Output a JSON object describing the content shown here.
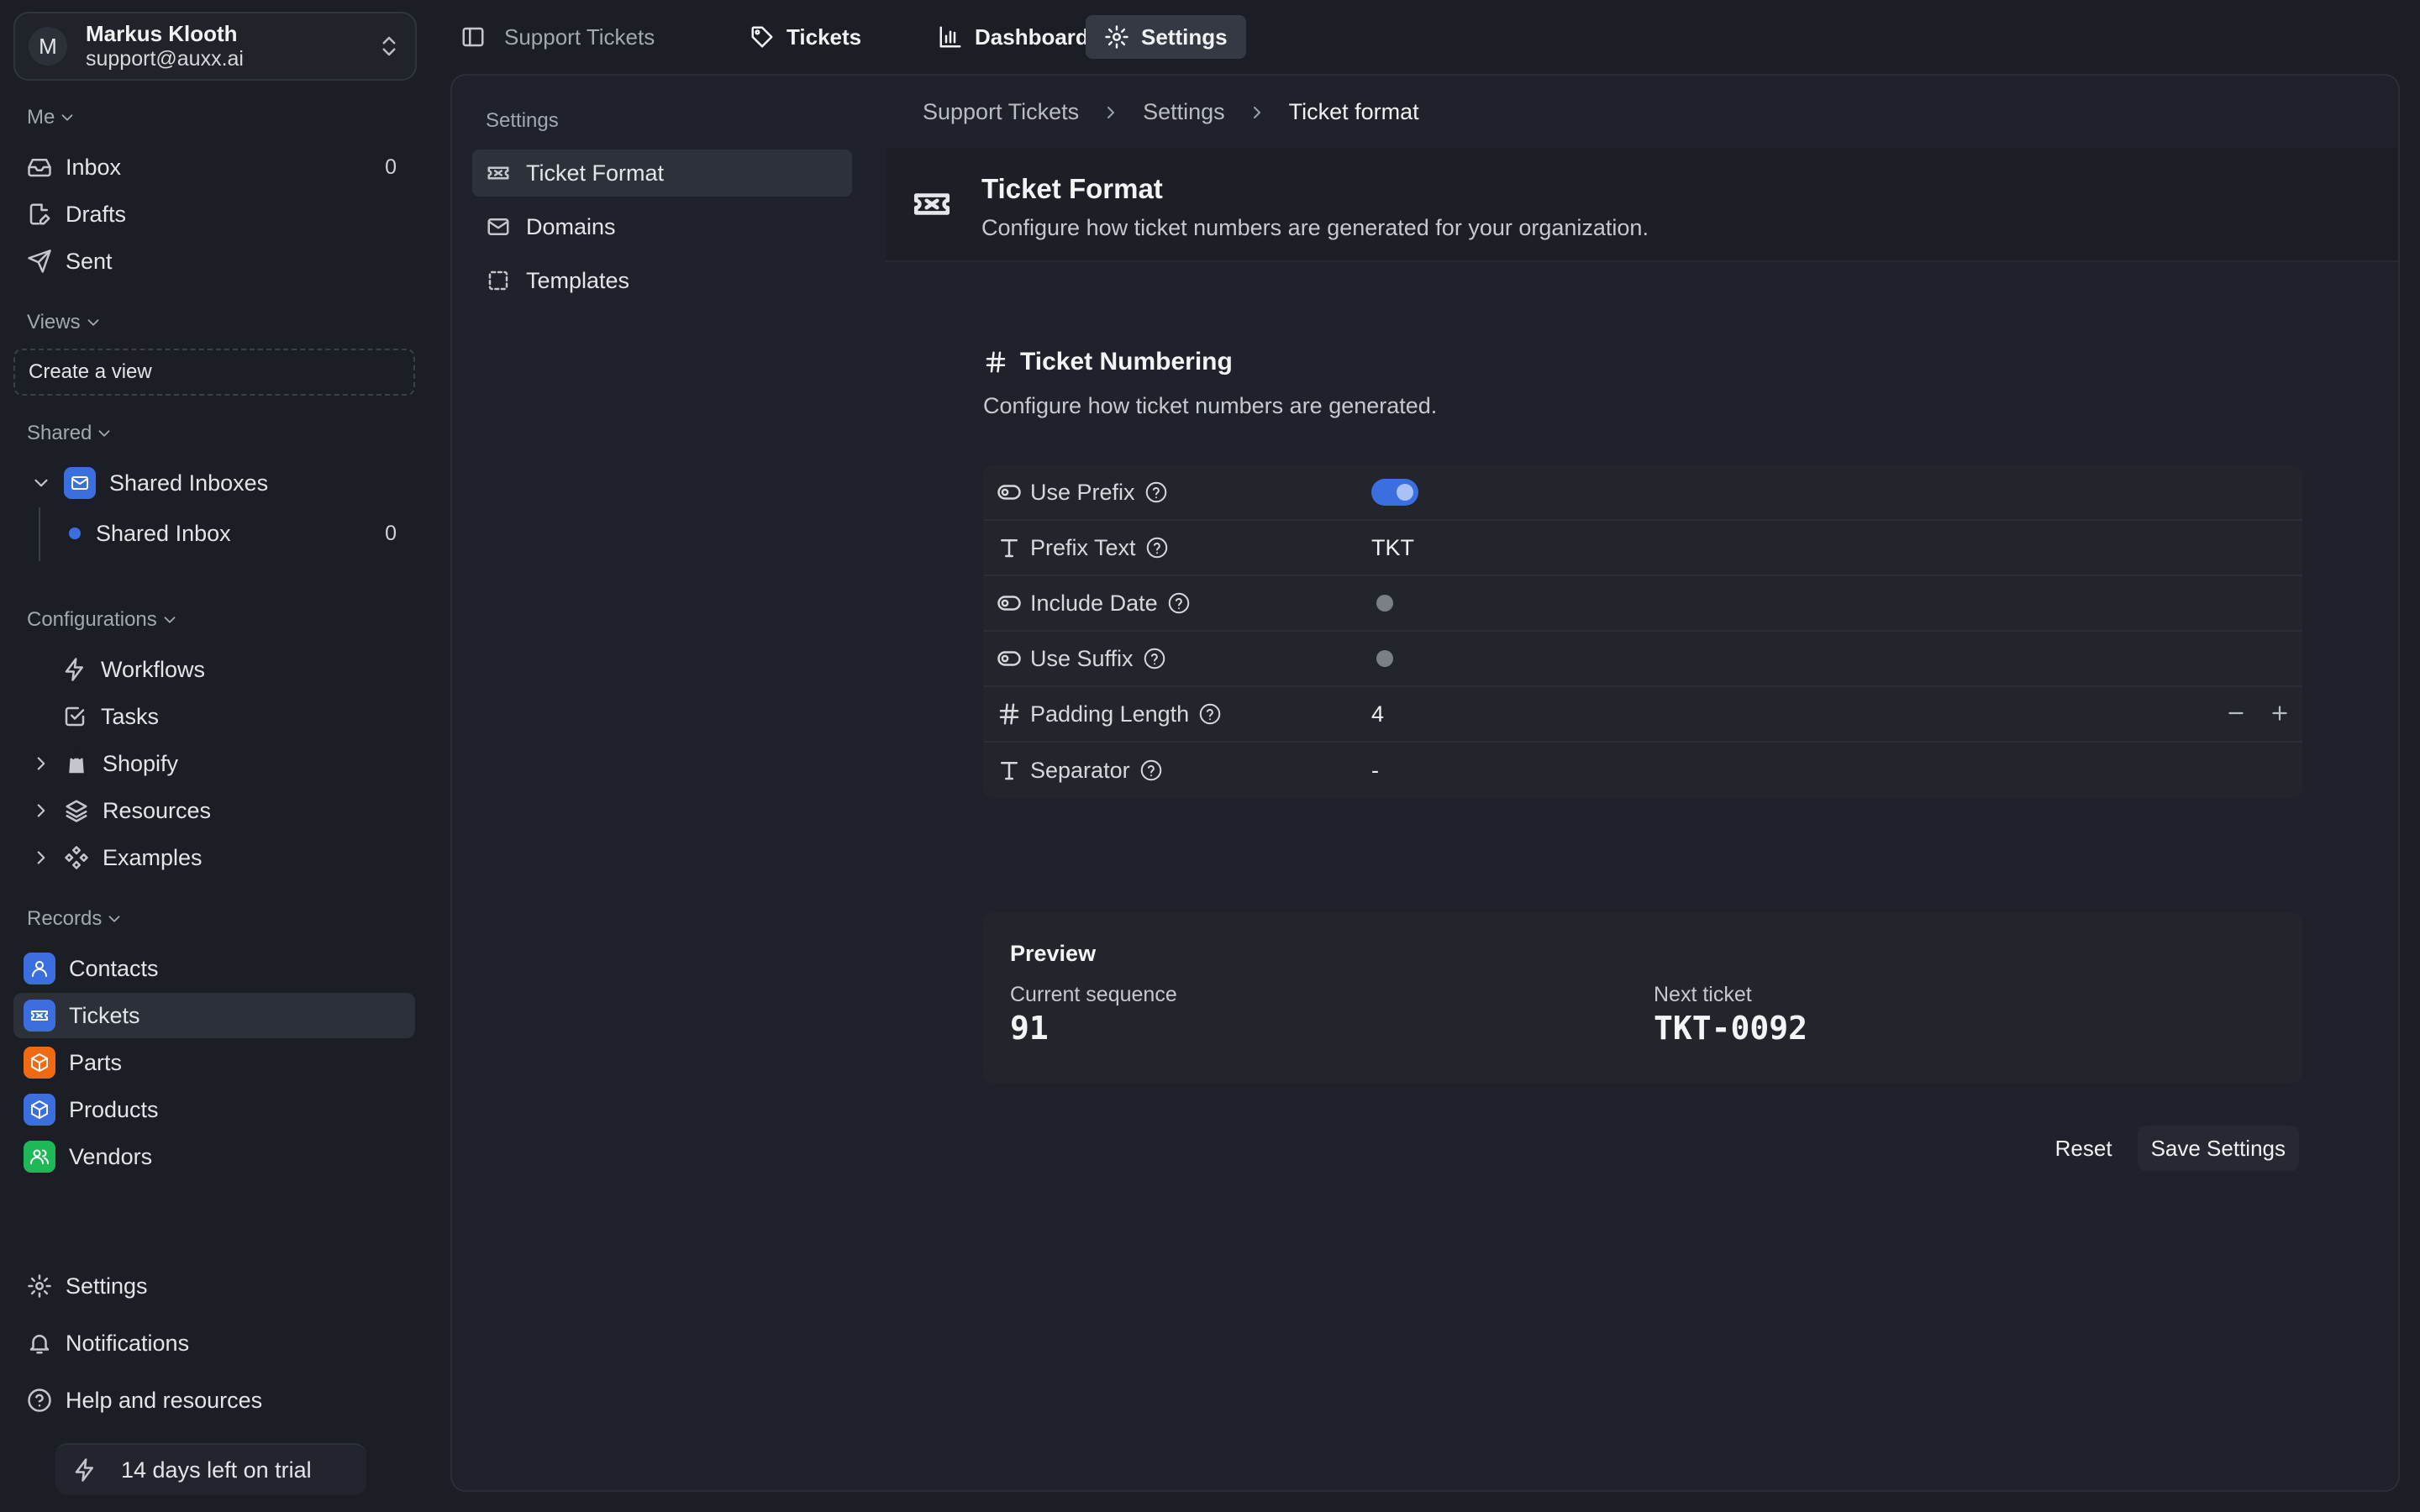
{
  "account": {
    "initial": "M",
    "name": "Markus Klooth",
    "email": "support@auxx.ai"
  },
  "sidebar": {
    "me_label": "Me",
    "me_items": [
      {
        "label": "Inbox",
        "count": "0",
        "icon": "inbox-icon"
      },
      {
        "label": "Drafts",
        "icon": "drafts-icon"
      },
      {
        "label": "Sent",
        "icon": "send-icon"
      }
    ],
    "views_label": "Views",
    "create_view": "Create a view",
    "shared_label": "Shared",
    "shared_inboxes": "Shared Inboxes",
    "shared_inbox": {
      "label": "Shared Inbox",
      "count": "0"
    },
    "config_label": "Configurations",
    "config_items": [
      {
        "label": "Workflows",
        "icon": "lightning-icon"
      },
      {
        "label": "Tasks",
        "icon": "checkbox-icon"
      },
      {
        "label": "Shopify",
        "icon": "shopping-bag-icon"
      },
      {
        "label": "Resources",
        "icon": "layers-icon"
      },
      {
        "label": "Examples",
        "icon": "components-icon"
      }
    ],
    "records_label": "Records",
    "records": [
      {
        "label": "Contacts",
        "color": "#3b6fe0",
        "icon": "user-icon"
      },
      {
        "label": "Tickets",
        "color": "#3b6fe0",
        "icon": "ticket-icon"
      },
      {
        "label": "Parts",
        "color": "#f06a14",
        "icon": "box-icon"
      },
      {
        "label": "Products",
        "color": "#3b6fe0",
        "icon": "box-icon"
      },
      {
        "label": "Vendors",
        "color": "#1fb857",
        "icon": "users-icon"
      }
    ],
    "bottom": [
      {
        "label": "Settings",
        "icon": "gear-icon"
      },
      {
        "label": "Notifications",
        "icon": "bell-icon"
      },
      {
        "label": "Help and resources",
        "icon": "help-circle-icon"
      }
    ],
    "trial": "14 days left on trial"
  },
  "topbar": {
    "title": "Support Tickets",
    "tabs": [
      "Tickets",
      "Dashboard",
      "Settings"
    ]
  },
  "settings_nav": {
    "label": "Settings",
    "items": [
      "Ticket Format",
      "Domains",
      "Templates"
    ]
  },
  "breadcrumb": [
    "Support Tickets",
    "Settings",
    "Ticket format"
  ],
  "header": {
    "title": "Ticket Format",
    "subtitle": "Configure how ticket numbers are generated for your organization."
  },
  "numbering": {
    "title": "Ticket Numbering",
    "description": "Configure how ticket numbers are generated.",
    "fields": {
      "use_prefix": {
        "label": "Use Prefix",
        "value": true
      },
      "prefix_text": {
        "label": "Prefix Text",
        "value": "TKT"
      },
      "include_date": {
        "label": "Include Date",
        "value": false
      },
      "use_suffix": {
        "label": "Use Suffix",
        "value": false
      },
      "padding_length": {
        "label": "Padding Length",
        "value": "4"
      },
      "separator": {
        "label": "Separator",
        "value": "-"
      }
    }
  },
  "preview": {
    "title": "Preview",
    "current_label": "Current sequence",
    "current_value": "91",
    "next_label": "Next ticket",
    "next_value": "TKT-0092"
  },
  "actions": {
    "reset": "Reset",
    "save": "Save Settings"
  },
  "colors": {
    "accent": "#3b6fe0",
    "orange": "#f06a14",
    "green": "#1fb857"
  }
}
